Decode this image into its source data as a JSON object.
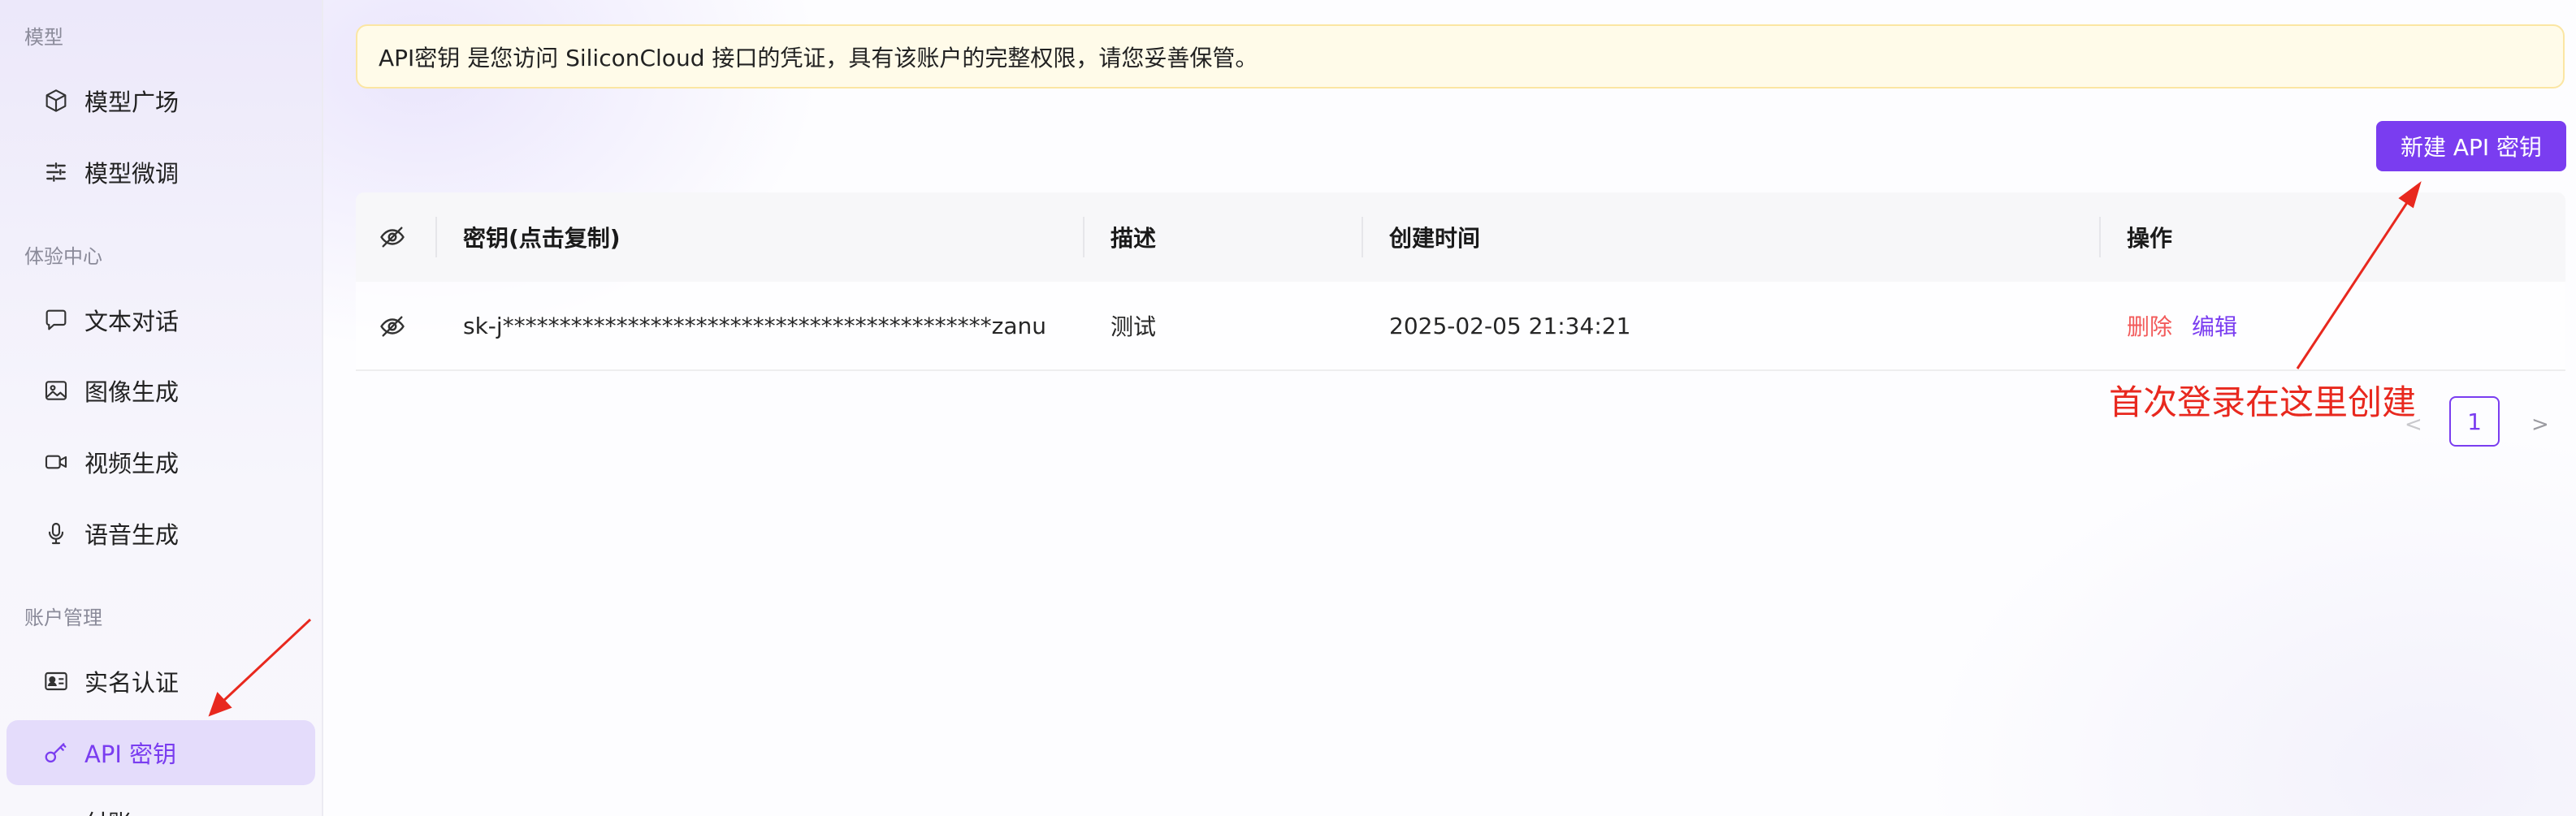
{
  "sidebar": {
    "groups": [
      {
        "title": "模型"
      },
      {
        "title": "体验中心"
      },
      {
        "title": "账户管理"
      }
    ],
    "items": [
      {
        "label": "模型广场",
        "icon": "cube-icon"
      },
      {
        "label": "模型微调",
        "icon": "sliders-icon"
      },
      {
        "label": "文本对话",
        "icon": "chat-bubble-icon"
      },
      {
        "label": "图像生成",
        "icon": "image-icon"
      },
      {
        "label": "视频生成",
        "icon": "video-camera-icon"
      },
      {
        "label": "语音生成",
        "icon": "microphone-icon"
      },
      {
        "label": "实名认证",
        "icon": "id-card-icon"
      },
      {
        "label": "API 密钥",
        "icon": "key-icon",
        "active": true
      },
      {
        "label": "付账",
        "icon": "partial-icon"
      }
    ]
  },
  "alert": {
    "text": "API密钥 是您访问 SiliconCloud 接口的凭证，具有该账户的完整权限，请您妥善保管。"
  },
  "toolbar": {
    "create_label": "新建 API 密钥"
  },
  "table": {
    "headers": {
      "key": "密钥(点击复制)",
      "description": "描述",
      "created": "创建时间",
      "actions": "操作"
    },
    "rows": [
      {
        "key": "sk-j*******************************************zanu",
        "description": "测试",
        "created": "2025-02-05 21:34:21",
        "delete_label": "删除",
        "edit_label": "编辑"
      }
    ]
  },
  "pagination": {
    "prev": "<",
    "current": "1",
    "next": ">"
  },
  "annotation": {
    "text": "首次登录在这里创建",
    "color": "#e8281e"
  },
  "colors": {
    "accent": "#7a3df0",
    "danger": "#f25a5a",
    "alert_bg": "#fffbe9"
  }
}
